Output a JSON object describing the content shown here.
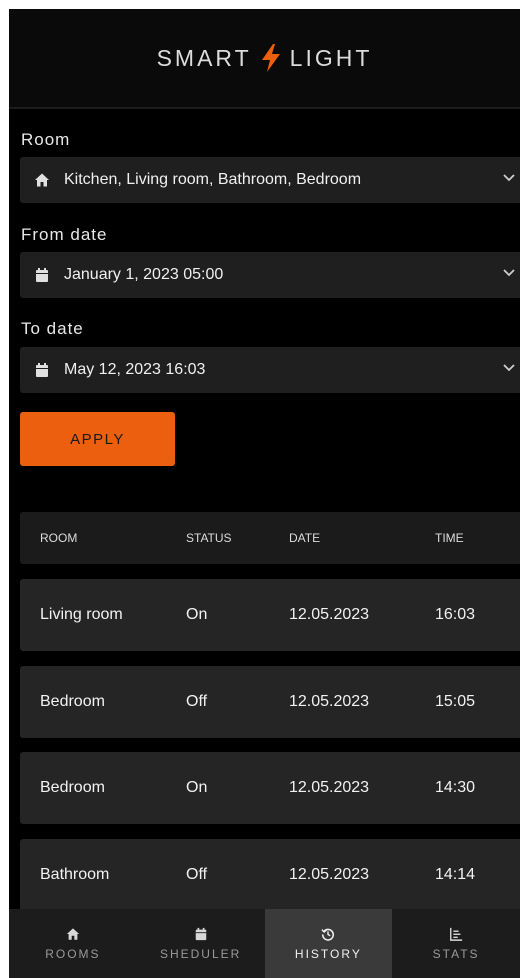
{
  "app": {
    "brand_left": "SMART",
    "brand_right": "LIGHT",
    "accent": "#ec5f0e"
  },
  "filters": {
    "room_label": "Room",
    "room_value": "Kitchen, Living room, Bathroom, Bedroom",
    "room_icon": "home-icon",
    "from_label": "From date",
    "from_value": "January 1, 2023 05:00",
    "from_icon": "calendar-icon",
    "to_label": "To date",
    "to_value": "May 12, 2023 16:03",
    "to_icon": "calendar-icon",
    "apply_label": "APPLY"
  },
  "table": {
    "headers": [
      "ROOM",
      "STATUS",
      "DATE",
      "TIME"
    ],
    "rows": [
      [
        "Living room",
        "On",
        "12.05.2023",
        "16:03"
      ],
      [
        "Bedroom",
        "Off",
        "12.05.2023",
        "15:05"
      ],
      [
        "Bedroom",
        "On",
        "12.05.2023",
        "14:30"
      ],
      [
        "Bathroom",
        "Off",
        "12.05.2023",
        "14:14"
      ]
    ]
  },
  "nav": {
    "items": [
      {
        "label": "ROOMS",
        "icon": "home-icon",
        "active": false
      },
      {
        "label": "SHEDULER",
        "icon": "calendar-icon",
        "active": false
      },
      {
        "label": "HISTORY",
        "icon": "history-icon",
        "active": true
      },
      {
        "label": "STATS",
        "icon": "bar-chart-icon",
        "active": false
      }
    ]
  }
}
